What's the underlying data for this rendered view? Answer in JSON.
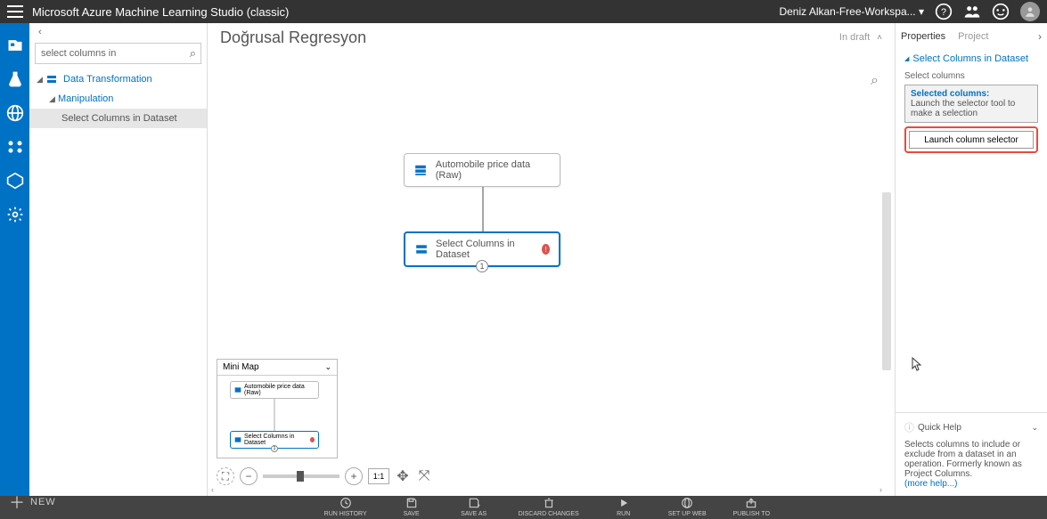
{
  "topbar": {
    "title": "Microsoft Azure Machine Learning Studio (classic)",
    "workspace": "Deniz Alkan-Free-Workspa..."
  },
  "palette": {
    "search_value": "select columns in",
    "tree": {
      "root_label": "Data Transformation",
      "manip_label": "Manipulation",
      "leaf_label": "Select Columns in Dataset"
    }
  },
  "canvas": {
    "title": "Doğrusal Regresyon",
    "draft": "In draft",
    "node1": "Automobile price data (Raw)",
    "node2": "Select Columns in Dataset",
    "node2_port": "1"
  },
  "minimap": {
    "title": "Mini Map",
    "n1": "Automobile price data (Raw)",
    "n2": "Select Columns in Dataset",
    "port": "1"
  },
  "zoom": {
    "ratio": "1:1"
  },
  "props": {
    "tab_properties": "Properties",
    "tab_project": "Project",
    "section_title": "Select Columns in Dataset",
    "select_label": "Select columns",
    "selcols_title": "Selected columns:",
    "selcols_text": "Launch the selector tool to make a selection",
    "launch_btn": "Launch column selector"
  },
  "quickhelp": {
    "title": "Quick Help",
    "body": "Selects columns to include or exclude from a dataset in an operation. Formerly known as Project Columns.",
    "more": "(more help...)"
  },
  "actionbar": {
    "new": "NEW",
    "items": {
      "run_history": "RUN HISTORY",
      "save": "SAVE",
      "save_as": "SAVE AS",
      "discard": "DISCARD CHANGES",
      "run": "RUN",
      "setup_web": "SET UP WEB",
      "publish": "PUBLISH TO"
    }
  }
}
